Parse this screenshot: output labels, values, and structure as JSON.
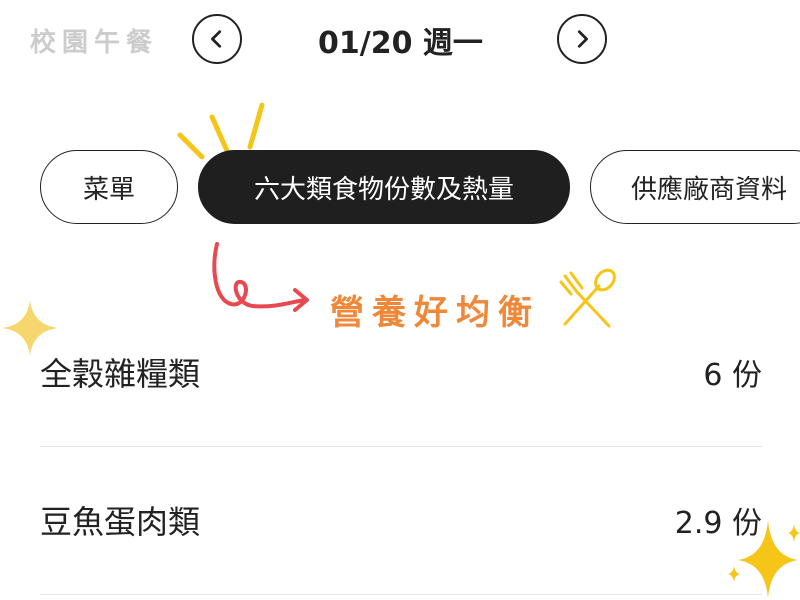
{
  "header": {
    "app_title": "校園午餐",
    "date_label": "01/20 週一",
    "prev_icon": "chevron-left-icon",
    "next_icon": "chevron-right-icon"
  },
  "tabs": [
    {
      "label": "菜單",
      "active": false
    },
    {
      "label": "六大類食物份數及熱量",
      "active": true
    },
    {
      "label": "供應廠商資料",
      "active": false
    }
  ],
  "slogan": "營養好均衡",
  "decorations": {
    "accent_yellow": "#f5c518",
    "accent_red": "#e8484f",
    "accent_orange": "#f0883a",
    "icons": [
      "sparkle-icon",
      "curly-arrow-icon",
      "fork-spoon-icon"
    ]
  },
  "food_groups": [
    {
      "name": "全穀雜糧類",
      "amount": "6 份"
    },
    {
      "name": "豆魚蛋肉類",
      "amount": "2.9 份"
    }
  ]
}
